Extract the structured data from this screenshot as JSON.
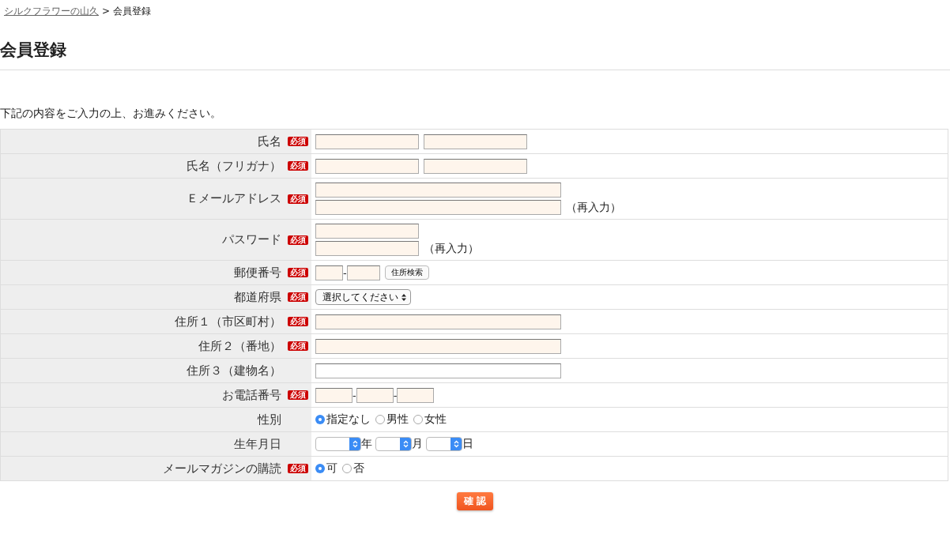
{
  "breadcrumb": {
    "link": "シルクフラワーの山久",
    "separator": ">",
    "current": "会員登録"
  },
  "title": "会員登録",
  "intro": "下記の内容をご入力の上、お進みください。",
  "rows": [
    {
      "label": "氏名",
      "badge": "必須",
      "kind": "pair"
    },
    {
      "label": "氏名（フリガナ）",
      "badge": "必須",
      "kind": "pair"
    },
    {
      "label": "Ｅメールアドレス",
      "badge": "必須",
      "kind": "double-wide",
      "note": "（再入力）"
    },
    {
      "label": "パスワード",
      "badge": "必須",
      "kind": "double",
      "note": "（再入力）"
    },
    {
      "label": "郵便番号",
      "badge": "必須",
      "kind": "zip",
      "separator": "-",
      "button": "住所検索"
    },
    {
      "label": "都道府県",
      "badge": "必須",
      "kind": "select",
      "value": "選択してください"
    },
    {
      "label": "住所１（市区町村）",
      "badge": "必須",
      "kind": "wide"
    },
    {
      "label": "住所２（番地）",
      "badge": "必須",
      "kind": "wide"
    },
    {
      "label": "住所３（建物名）",
      "kind": "wide"
    },
    {
      "label": "お電話番号",
      "badge": "必須",
      "kind": "phone",
      "separators": [
        "-",
        "-"
      ]
    },
    {
      "label": "性別",
      "kind": "radio",
      "options": [
        {
          "label": "指定なし",
          "selected": true
        },
        {
          "label": "男性",
          "selected": false
        },
        {
          "label": "女性",
          "selected": false
        }
      ]
    },
    {
      "label": "生年月日",
      "kind": "date",
      "units": [
        "年",
        "月",
        "日"
      ]
    },
    {
      "label": "メールマガジンの購読",
      "badge": "必須",
      "kind": "radio",
      "options": [
        {
          "label": "可",
          "selected": true
        },
        {
          "label": "否",
          "selected": false
        }
      ]
    }
  ],
  "submit": "確 認"
}
